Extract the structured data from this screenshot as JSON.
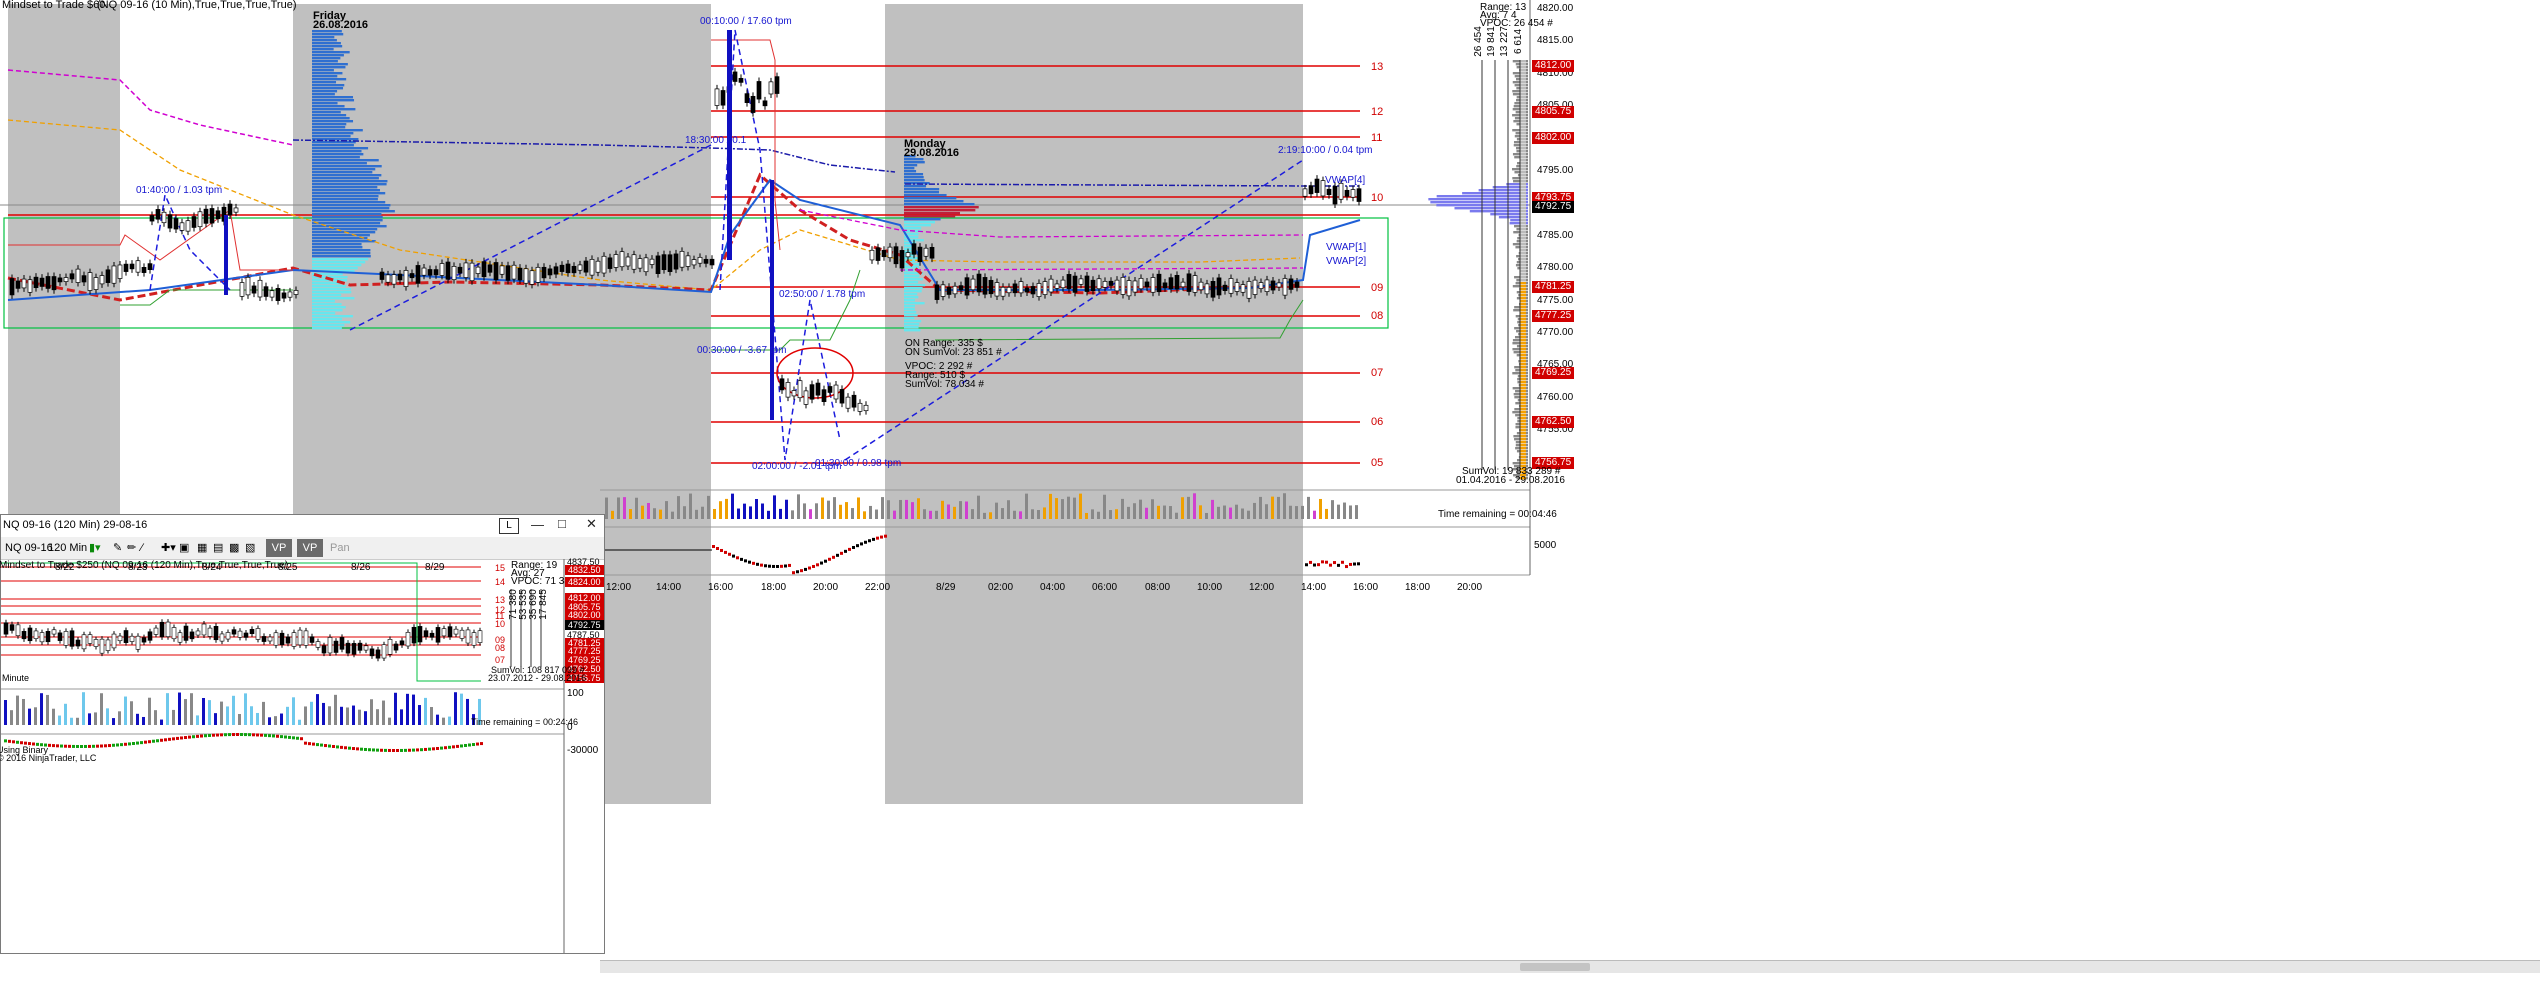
{
  "main": {
    "title_left": "Mindset to Trade  $60",
    "instrument_line": "(NQ 09-16 (10 Min),True,True,True,True)",
    "stats": {
      "range": "Range: 13",
      "avg": "Avg:       7 4",
      "vpoc": "VPOC:    26 454 #"
    },
    "volume_cols": [
      "26 454",
      "19 841",
      "13 227",
      "6 614"
    ],
    "sessions": [
      {
        "day": "Friday",
        "date": "26.08.2016"
      },
      {
        "day": "Monday",
        "date": "29.08.2016"
      }
    ],
    "swing_labels": [
      "01:40:00 / 1.03 tpm",
      "00:10:00 / 17.60 tpm",
      "18:30:00 / 0.1",
      "00:30:00 / -3.67 tpm",
      "02:50:00 / 1.78 tpm",
      "02:00:00 / -2.01 tpm",
      "01:30:00 / 0.98 tpm",
      "2:19:10:00 / 0.04 tpm"
    ],
    "vwap_labels": [
      "VWAP[4]",
      "VWAP[1]",
      "VWAP[2]"
    ],
    "on_stats": [
      "ON Range:    335 $",
      "ON SumVol:  23 851 #",
      "VPOC:    2 292 #",
      "Range:    510 $",
      "SumVol:  78 034 #"
    ],
    "level_numbers": [
      "13",
      "12",
      "11",
      "10",
      "09",
      "08",
      "07",
      "06",
      "05"
    ],
    "price_axis": [
      "4820.00",
      "4815.00",
      "4810.00",
      "4805.00",
      "4800.00",
      "4795.00",
      "4790.00",
      "4785.00",
      "4780.00",
      "4775.00",
      "4770.00",
      "4765.00",
      "4760.00",
      "4755.00"
    ],
    "price_tags_red": [
      "4812.00",
      "4805.75",
      "4802.00",
      "4793.75",
      "4781.25",
      "4777.25",
      "4769.25",
      "4762.50",
      "4756.75"
    ],
    "price_tag_black": "4792.75",
    "sumvol": "SumVol: 19 833 289 #",
    "date_range": "01.04.2016 - 29.08.2016",
    "time_remaining": "Time remaining = 00:04:46",
    "vol_axis": "5000",
    "time_axis": [
      "12:00",
      "14:00",
      "16:00",
      "18:00",
      "20:00",
      "22:00",
      "8/29",
      "02:00",
      "04:00",
      "06:00",
      "08:00",
      "10:00",
      "12:00",
      "14:00",
      "16:00",
      "18:00",
      "20:00"
    ]
  },
  "sub": {
    "window_title": "NQ 09-16 (120 Min)  29-08-16",
    "win_btn_l": "L",
    "toolbar": {
      "instrument": "NQ 09-16",
      "period": "120 Min",
      "vp1": "VP",
      "vp2": "VP",
      "pan": "Pan"
    },
    "title": "Mindset to Trade  $250   (NQ 09-16 (120 Min),True,True,True,True)",
    "stats": {
      "range": "Range: 19",
      "avg": "Avg:      27",
      "vpoc": "VPOC:   71 380 #"
    },
    "vol_cols": [
      "71 380",
      "53 535",
      "35 690",
      "17 845"
    ],
    "level_numbers": [
      "15",
      "14",
      "13",
      "12",
      "11",
      "10",
      "09",
      "08",
      "07"
    ],
    "price_tags_red": [
      "4832.50",
      "4824.00",
      "4812.00",
      "4805.75",
      "4802.00",
      "4781.25",
      "4777.25",
      "4769.25",
      "4762.50",
      "4756.75"
    ],
    "price_tag_black": "4792.75",
    "top_price": "4837.50",
    "mid_price": "4787.50",
    "sumvol": "SumVol: 108 817 099 #",
    "date_range": "23.07.2012 - 29.08.2016",
    "minute_label": "Minute",
    "time_remaining": "Time remaining = 00:24:46",
    "vol_axis": [
      "100",
      "0"
    ],
    "osc_axis": "-30000",
    "credit": [
      "Using Binary",
      "© 2016 NinjaTrader, LLC"
    ],
    "date_axis": [
      "8/22",
      "8/23",
      "8/24",
      "8/25",
      "8/26",
      "8/29"
    ]
  },
  "colors": {
    "session_shade": "#c0c0c0",
    "red_level": "#e00000",
    "candle_up": "#ffffff",
    "candle_down": "#000000",
    "vwap_blue": "#1f5fd6",
    "profile_blue": "#2f6fd0",
    "profile_cyan": "#66e6ee",
    "magenta": "#e000e0",
    "orange": "#f5a000",
    "green": "#00b000"
  }
}
